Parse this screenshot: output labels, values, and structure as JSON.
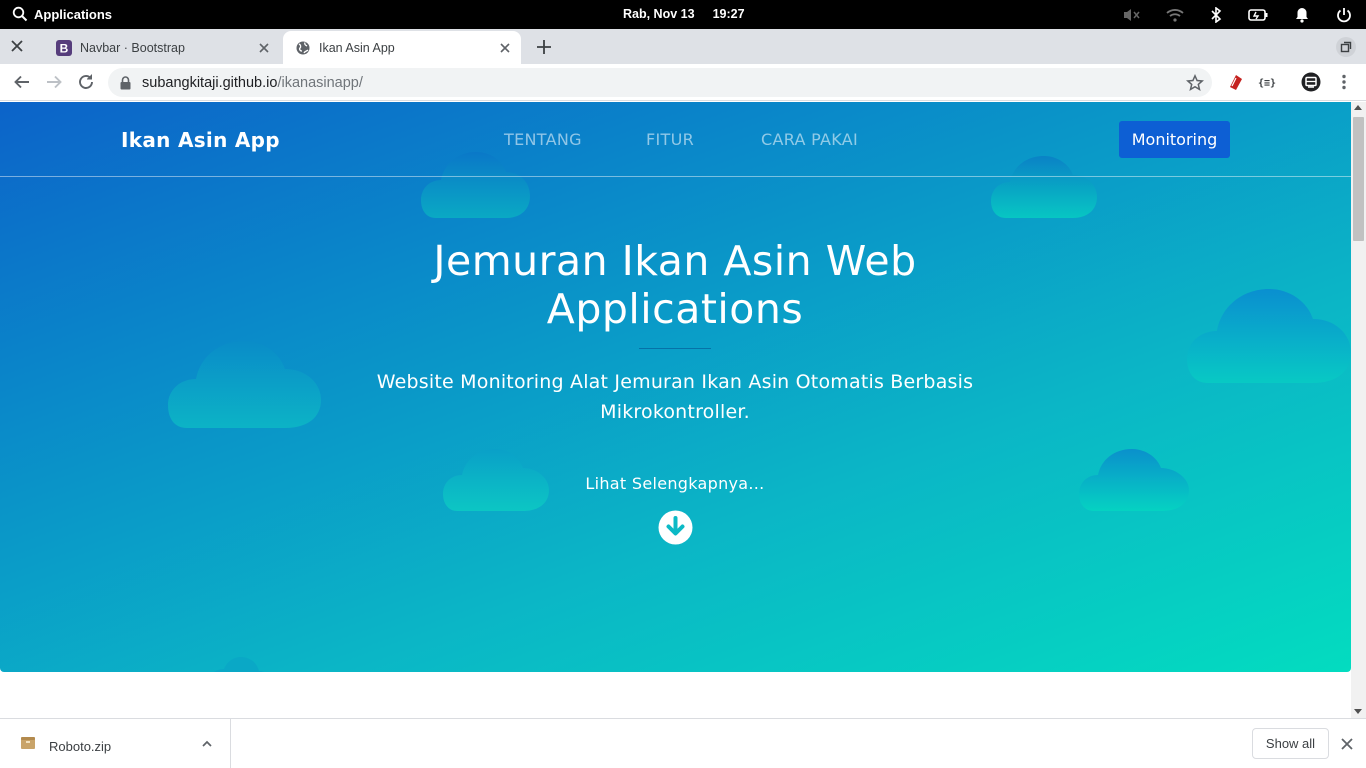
{
  "os": {
    "apps_label": "Applications",
    "date": "Rab, Nov 13",
    "time": "19:27",
    "tray_icons": [
      "volume-muted-icon",
      "wifi-icon",
      "bluetooth-icon",
      "battery-icon",
      "notification-bell-icon",
      "power-icon"
    ]
  },
  "browser": {
    "tabs": [
      {
        "title": "Navbar · Bootstrap",
        "favicon": "bootstrap-favicon",
        "active": false
      },
      {
        "title": "Ikan Asin App",
        "favicon": "globe-icon",
        "active": true
      }
    ],
    "url": {
      "host": "subangkitaji.github.io",
      "path": "/ikanasinapp/"
    }
  },
  "page": {
    "brand": "Ikan Asin App",
    "nav": [
      {
        "label": "TENTANG"
      },
      {
        "label": "FITUR"
      },
      {
        "label": "CARA PAKAI"
      }
    ],
    "cta_label": "Monitoring",
    "hero": {
      "title": "Jemuran Ikan Asin Web Applications",
      "subtitle": "Website Monitoring Alat Jemuran Ikan Asin Otomatis Berbasis Mikrokontroller.",
      "more_label": "Lihat Selengkapnya..."
    },
    "colors": {
      "gradient_start": "#0c63c9",
      "gradient_end": "#03dcc0",
      "cta_bg": "#0d5fd4"
    }
  },
  "downloads": {
    "file_name": "Roboto.zip",
    "show_all_label": "Show all"
  }
}
